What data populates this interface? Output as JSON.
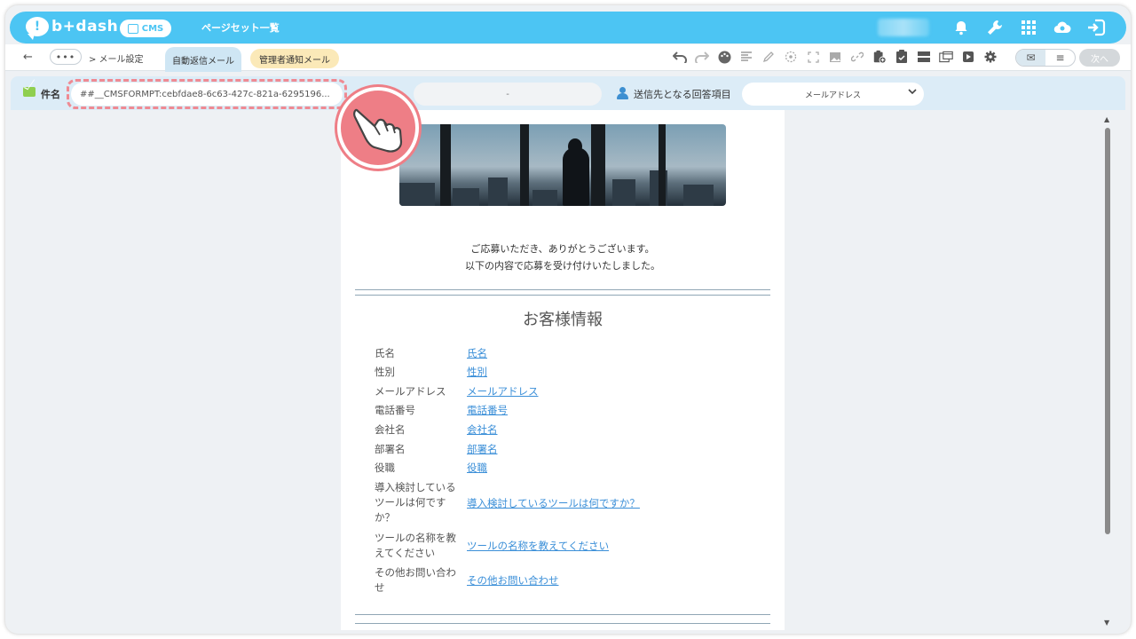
{
  "header": {
    "logo_text": "b+dash",
    "logo_mark": "!",
    "cms_label": "CMS",
    "page_set_label": "ページセット一覧",
    "icons": [
      "bell-icon",
      "wrench-icon",
      "grid-icon",
      "cloud-icon",
      "logout-icon"
    ]
  },
  "toolbar": {
    "back_glyph": "←",
    "more_label": "•••",
    "breadcrumb": "> メール設定",
    "tabs": [
      "自動返信メール",
      "管理者通知メール"
    ],
    "tools": [
      "undo-icon",
      "redo-icon",
      "palette-icon",
      "text-align-icon",
      "pen-icon",
      "target-icon",
      "fullscreen-icon",
      "image-icon",
      "link-icon",
      "clipboard-add-icon",
      "clipboard-check-icon",
      "layout-icon",
      "window-icon",
      "play-icon",
      "gear-icon"
    ],
    "view_mail_glyph": "✉",
    "view_text_glyph": "≡",
    "next_label": "次へ"
  },
  "subject": {
    "label": "件名",
    "value": "##__CMSFORMPT:cebfdae8-6c63-427c-821a-6295196...",
    "from_value": "-",
    "recipient_label": "送信先となる回答項目",
    "recipient_value": "メールアドレス"
  },
  "email": {
    "intro_line1": "ご応募いただき、ありがとうございます。",
    "intro_line2": "以下の内容で応募を受け付けいたしました。",
    "section_title": "お客様情報",
    "fields": [
      {
        "label": "氏名",
        "value": "氏名"
      },
      {
        "label": "性別",
        "value": "性別"
      },
      {
        "label": "メールアドレス",
        "value": "メールアドレス"
      },
      {
        "label": "電話番号",
        "value": "電話番号"
      },
      {
        "label": "会社名",
        "value": "会社名"
      },
      {
        "label": "部署名",
        "value": "部署名"
      },
      {
        "label": "役職",
        "value": "役職"
      },
      {
        "label": "導入検討している\nツールは何です\nか？",
        "value": "導入検討しているツールは何ですか？"
      },
      {
        "label": "ツールの名称を教\nえてください",
        "value": "ツールの名称を教えてください"
      },
      {
        "label": "その他お問い合わ\nせ",
        "value": "その他お問い合わせ"
      }
    ]
  },
  "colors": {
    "brand": "#4cc5f3",
    "link": "#3b8fd8",
    "highlight": "#ee7e86"
  }
}
